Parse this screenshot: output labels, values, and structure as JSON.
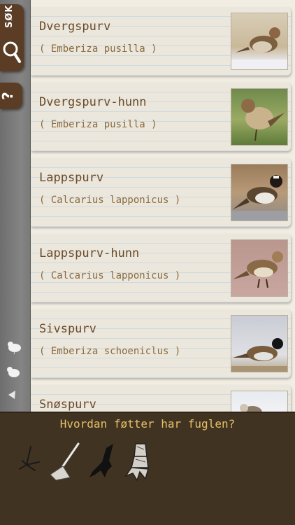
{
  "sidebar": {
    "search_label": "SØK",
    "help_label": "?"
  },
  "birds": [
    {
      "name": "Dvergspurv",
      "latin": "( Emberiza pusilla )"
    },
    {
      "name": "Dvergspurv-hunn",
      "latin": "( Emberiza pusilla )"
    },
    {
      "name": "Lappspurv",
      "latin": "( Calcarius lapponicus )"
    },
    {
      "name": "Lappspurv-hunn",
      "latin": "( Calcarius lapponicus )"
    },
    {
      "name": "Sivspurv",
      "latin": "( Emberiza schoeniclus )"
    },
    {
      "name": "Snøspurv",
      "latin": ""
    }
  ],
  "filter_panel": {
    "question": "Hvordan føtter har fuglen?"
  },
  "colors": {
    "rail": "#7a7a7a",
    "tab": "#5a3d24",
    "panel": "#413321",
    "accent_text": "#e6c06a",
    "name_text": "#6b4a26"
  }
}
